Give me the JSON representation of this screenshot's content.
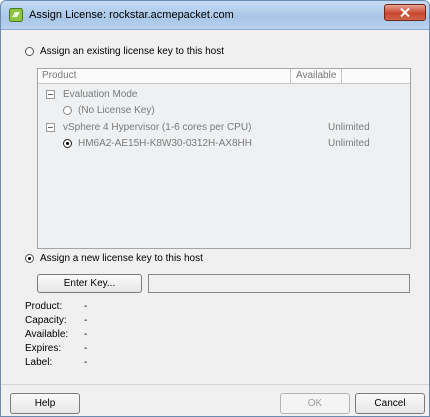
{
  "window": {
    "title": "Assign License: rockstar.acmepacket.com"
  },
  "options": {
    "existing_label": "Assign an existing license key to this host",
    "new_label": "Assign a new license key to this host"
  },
  "license_table": {
    "columns": [
      "Product",
      "Available"
    ],
    "rows": [
      {
        "label": "Evaluation Mode",
        "available": ""
      },
      {
        "label": "(No License Key)",
        "available": ""
      },
      {
        "label": "vSphere 4 Hypervisor (1-6 cores per CPU)",
        "available": "Unlimited"
      },
      {
        "label": "HM6A2-AE15H-K8W30-0312H-AX8HH",
        "available": "Unlimited"
      }
    ]
  },
  "enter_key_button": "Enter Key...",
  "details": [
    {
      "label": "Product:",
      "value": "-"
    },
    {
      "label": "Capacity:",
      "value": "-"
    },
    {
      "label": "Available:",
      "value": "-"
    },
    {
      "label": "Expires:",
      "value": "-"
    },
    {
      "label": "Label:",
      "value": "-"
    }
  ],
  "footer": {
    "help": "Help",
    "ok": "OK",
    "cancel": "Cancel"
  }
}
